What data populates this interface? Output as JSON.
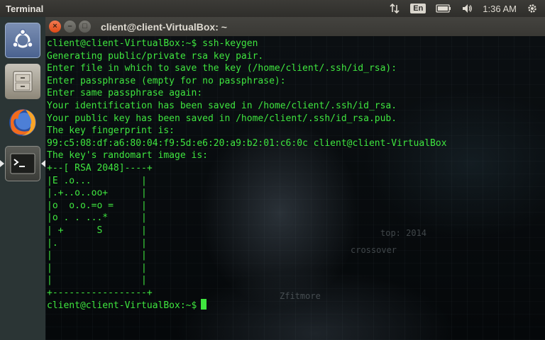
{
  "panel": {
    "app_title": "Terminal",
    "language": "En",
    "clock": "1:36 AM",
    "icons": [
      "network-arrows-icon",
      "keyboard-language-icon",
      "battery-icon",
      "volume-icon",
      "settings-gear-icon"
    ]
  },
  "launcher": {
    "items": [
      {
        "name": "dash-home",
        "icon": "ubuntu-logo-icon"
      },
      {
        "name": "files",
        "icon": "file-cabinet-icon"
      },
      {
        "name": "firefox",
        "icon": "firefox-icon"
      },
      {
        "name": "terminal",
        "icon": "terminal-icon",
        "active": true
      }
    ]
  },
  "window": {
    "title": "client@client-VirtualBox: ~",
    "buttons": [
      "×",
      "–",
      "□"
    ]
  },
  "terminal": {
    "lines": [
      "client@client-VirtualBox:~$ ssh-keygen",
      "Generating public/private rsa key pair.",
      "Enter file in which to save the key (/home/client/.ssh/id_rsa):",
      "Enter passphrase (empty for no passphrase):",
      "Enter same passphrase again:",
      "Your identification has been saved in /home/client/.ssh/id_rsa.",
      "Your public key has been saved in /home/client/.ssh/id_rsa.pub.",
      "The key fingerprint is:",
      "99:c5:08:df:a6:80:04:f9:5d:e6:20:a9:b2:01:c6:0c client@client-VirtualBox",
      "The key's randomart image is:",
      "+--[ RSA 2048]----+",
      "|E .o...         |",
      "|.+..o..oo+      |",
      "|o  o.o.=o =     |",
      "|o . . ...*      |",
      "| +      S       |",
      "|.               |",
      "|                |",
      "|                |",
      "|                |",
      "+-----------------+"
    ],
    "prompt": "client@client-VirtualBox:~$"
  },
  "wallpaper": {
    "texts": [
      "top: 2014",
      "crossover",
      "Zfitmore"
    ]
  },
  "colors": {
    "terminal_text": "#3fe63f",
    "panel_bg": "#3c3b37",
    "launcher_bg": "#2b3535",
    "close_button": "#df4a16"
  }
}
